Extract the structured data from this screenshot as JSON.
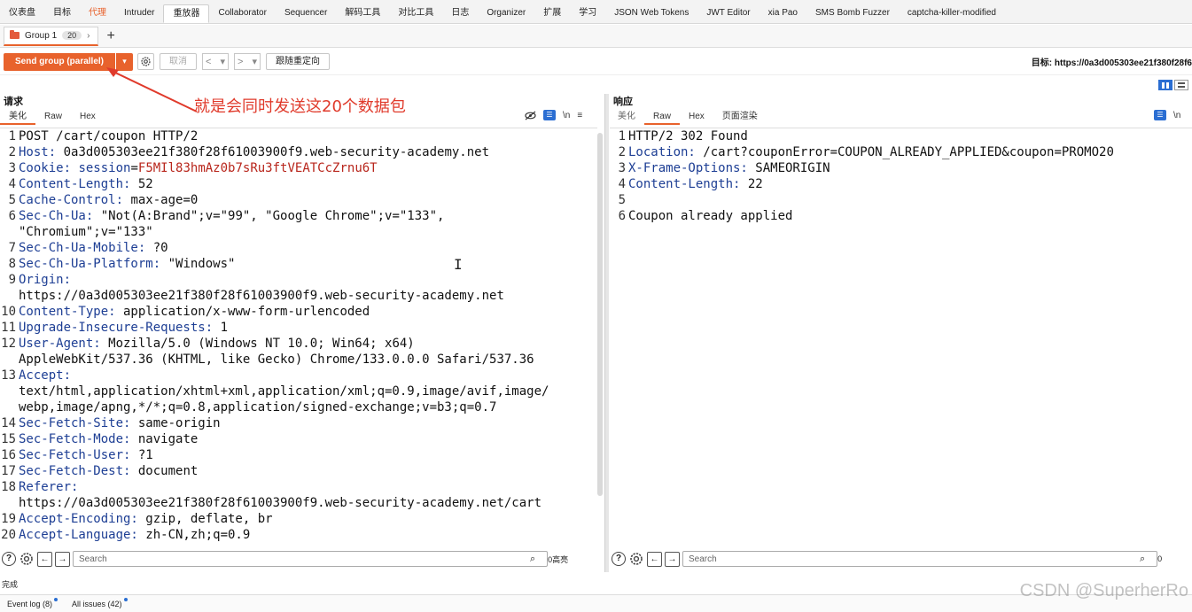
{
  "topbar": {
    "tabs": [
      "仪表盘",
      "目标",
      "代理",
      "Intruder",
      "重放器",
      "Collaborator",
      "Sequencer",
      "解码工具",
      "对比工具",
      "日志",
      "Organizer",
      "扩展",
      "学习",
      "JSON Web Tokens",
      "JWT Editor",
      "xia Pao",
      "SMS Bomb Fuzzer",
      "captcha-killer-modified"
    ]
  },
  "group_tab": {
    "label": "Group 1",
    "count": "20",
    "chevron": "›",
    "add": "+"
  },
  "toolbar": {
    "send_label": "Send group (parallel)",
    "send_dropdown": "▾",
    "cancel_label": "取消",
    "prev": "<",
    "next": ">",
    "follow_label": "跟随重定向",
    "target_label": "目标: https://0a3d005303ee21f380f28f6"
  },
  "annotation": "就是会同时发送这20个数据包",
  "request": {
    "title": "请求",
    "tabs": [
      "美化",
      "Raw",
      "Hex"
    ],
    "icon_wrap": "\\n",
    "icon_menu": "≡",
    "lines": [
      {
        "n": "1",
        "segs": [
          {
            "t": "POST /cart/coupon HTTP/2",
            "c": "hv"
          }
        ]
      },
      {
        "n": "2",
        "segs": [
          {
            "t": "Host:",
            "c": "hn"
          },
          {
            "t": " 0a3d005303ee21f380f28f61003900f9.web-security-academy.net",
            "c": "hv"
          }
        ]
      },
      {
        "n": "3",
        "segs": [
          {
            "t": "Cookie:",
            "c": "hn"
          },
          {
            "t": " session",
            "c": "hn"
          },
          {
            "t": "=",
            "c": "hv"
          },
          {
            "t": "F5MIl83hmAz0b7sRu3ftVEATCcZrnu6T",
            "c": "cv"
          }
        ]
      },
      {
        "n": "4",
        "segs": [
          {
            "t": "Content-Length:",
            "c": "hn"
          },
          {
            "t": " 52",
            "c": "hv"
          }
        ]
      },
      {
        "n": "5",
        "segs": [
          {
            "t": "Cache-Control:",
            "c": "hn"
          },
          {
            "t": " max-age=0",
            "c": "hv"
          }
        ]
      },
      {
        "n": "6",
        "segs": [
          {
            "t": "Sec-Ch-Ua:",
            "c": "hn"
          },
          {
            "t": " \"Not(A:Brand\";v=\"99\", \"Google Chrome\";v=\"133\",",
            "c": "hv"
          }
        ]
      },
      {
        "n": "",
        "segs": [
          {
            "t": "\"Chromium\";v=\"133\"",
            "c": "hv"
          }
        ]
      },
      {
        "n": "7",
        "segs": [
          {
            "t": "Sec-Ch-Ua-Mobile:",
            "c": "hn"
          },
          {
            "t": " ?0",
            "c": "hv"
          }
        ]
      },
      {
        "n": "8",
        "segs": [
          {
            "t": "Sec-Ch-Ua-Platform:",
            "c": "hn"
          },
          {
            "t": " \"Windows\"",
            "c": "hv"
          }
        ]
      },
      {
        "n": "9",
        "segs": [
          {
            "t": "Origin:",
            "c": "hn"
          }
        ]
      },
      {
        "n": "",
        "segs": [
          {
            "t": "https://0a3d005303ee21f380f28f61003900f9.web-security-academy.net",
            "c": "hv"
          }
        ]
      },
      {
        "n": "10",
        "segs": [
          {
            "t": "Content-Type:",
            "c": "hn"
          },
          {
            "t": " application/x-www-form-urlencoded",
            "c": "hv"
          }
        ]
      },
      {
        "n": "11",
        "segs": [
          {
            "t": "Upgrade-Insecure-Requests:",
            "c": "hn"
          },
          {
            "t": " 1",
            "c": "hv"
          }
        ]
      },
      {
        "n": "12",
        "segs": [
          {
            "t": "User-Agent:",
            "c": "hn"
          },
          {
            "t": " Mozilla/5.0 (Windows NT 10.0; Win64; x64)",
            "c": "hv"
          }
        ]
      },
      {
        "n": "",
        "segs": [
          {
            "t": "AppleWebKit/537.36 (KHTML, like Gecko) Chrome/133.0.0.0 Safari/537.36",
            "c": "hv"
          }
        ]
      },
      {
        "n": "13",
        "segs": [
          {
            "t": "Accept:",
            "c": "hn"
          }
        ]
      },
      {
        "n": "",
        "segs": [
          {
            "t": "text/html,application/xhtml+xml,application/xml;q=0.9,image/avif,image/",
            "c": "hv"
          }
        ]
      },
      {
        "n": "",
        "segs": [
          {
            "t": "webp,image/apng,*/*;q=0.8,application/signed-exchange;v=b3;q=0.7",
            "c": "hv"
          }
        ]
      },
      {
        "n": "14",
        "segs": [
          {
            "t": "Sec-Fetch-Site:",
            "c": "hn"
          },
          {
            "t": " same-origin",
            "c": "hv"
          }
        ]
      },
      {
        "n": "15",
        "segs": [
          {
            "t": "Sec-Fetch-Mode:",
            "c": "hn"
          },
          {
            "t": " navigate",
            "c": "hv"
          }
        ]
      },
      {
        "n": "16",
        "segs": [
          {
            "t": "Sec-Fetch-User:",
            "c": "hn"
          },
          {
            "t": " ?1",
            "c": "hv"
          }
        ]
      },
      {
        "n": "17",
        "segs": [
          {
            "t": "Sec-Fetch-Dest:",
            "c": "hn"
          },
          {
            "t": " document",
            "c": "hv"
          }
        ]
      },
      {
        "n": "18",
        "segs": [
          {
            "t": "Referer:",
            "c": "hn"
          }
        ]
      },
      {
        "n": "",
        "segs": [
          {
            "t": "https://0a3d005303ee21f380f28f61003900f9.web-security-academy.net/cart",
            "c": "hv"
          }
        ]
      },
      {
        "n": "19",
        "segs": [
          {
            "t": "Accept-Encoding:",
            "c": "hn"
          },
          {
            "t": " gzip, deflate, br",
            "c": "hv"
          }
        ]
      },
      {
        "n": "20",
        "segs": [
          {
            "t": "Accept-Language:",
            "c": "hn"
          },
          {
            "t": " zh-CN,zh;q=0.9",
            "c": "hv"
          }
        ]
      }
    ],
    "search_placeholder": "Search",
    "highlights": "0高亮"
  },
  "response": {
    "title": "响应",
    "tabs": [
      "美化",
      "Raw",
      "Hex",
      "页面渲染"
    ],
    "icon_wrap": "\\n",
    "lines": [
      {
        "n": "1",
        "segs": [
          {
            "t": "HTTP/2 302 Found",
            "c": "hv"
          }
        ]
      },
      {
        "n": "2",
        "segs": [
          {
            "t": "Location:",
            "c": "hn"
          },
          {
            "t": " /cart?couponError=COUPON_ALREADY_APPLIED&coupon=PROMO20",
            "c": "hv"
          }
        ]
      },
      {
        "n": "3",
        "segs": [
          {
            "t": "X-Frame-Options:",
            "c": "hn"
          },
          {
            "t": " SAMEORIGIN",
            "c": "hv"
          }
        ]
      },
      {
        "n": "4",
        "segs": [
          {
            "t": "Content-Length:",
            "c": "hn"
          },
          {
            "t": " 22",
            "c": "hv"
          }
        ]
      },
      {
        "n": "5",
        "segs": []
      },
      {
        "n": "6",
        "segs": [
          {
            "t": "Coupon already applied",
            "c": "hv"
          }
        ]
      }
    ],
    "search_placeholder": "Search",
    "highlights": "0"
  },
  "status": "完成",
  "bottombar": {
    "event_log": "Event log (8)",
    "all_issues": "All issues (42)"
  },
  "watermark": "CSDN @SuperherRo",
  "colors": {
    "accent": "#e8622c",
    "header_name": "#1d3e94",
    "cookie_value": "#b8261c",
    "annotation": "#e03a2b"
  }
}
